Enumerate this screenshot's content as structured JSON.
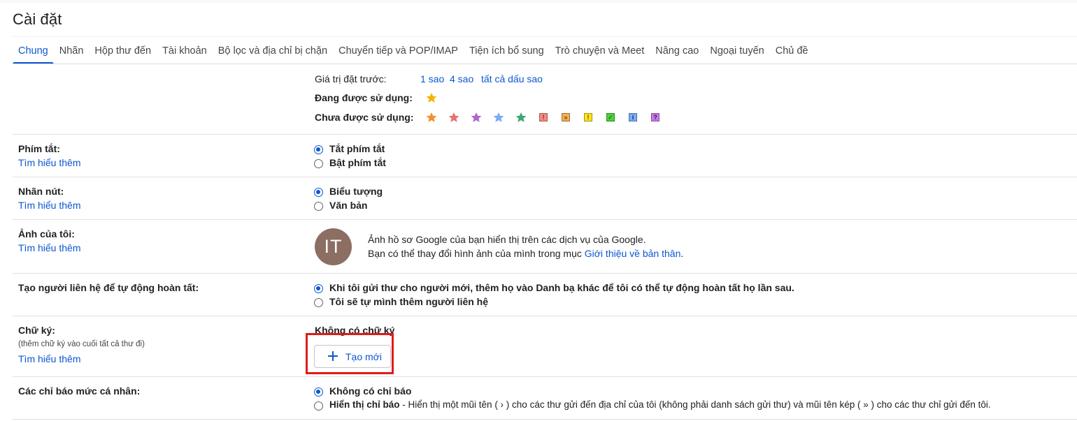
{
  "page_title": "Cài đặt",
  "tabs": [
    {
      "label": "Chung",
      "active": true
    },
    {
      "label": "Nhãn"
    },
    {
      "label": "Hộp thư đến"
    },
    {
      "label": "Tài khoản"
    },
    {
      "label": "Bộ lọc và địa chỉ bị chặn"
    },
    {
      "label": "Chuyển tiếp và POP/IMAP"
    },
    {
      "label": "Tiện ích bổ sung"
    },
    {
      "label": "Trò chuyện và Meet"
    },
    {
      "label": "Nâng cao"
    },
    {
      "label": "Ngoại tuyến"
    },
    {
      "label": "Chủ đề"
    }
  ],
  "stars": {
    "presets_label": "Giá trị đặt trước:",
    "preset_1": "1 sao",
    "preset_4": "4 sao",
    "preset_all": "tất cả dấu sao",
    "in_use_label": "Đang được sử dụng:",
    "not_in_use_label": "Chưa được sử dụng:",
    "in_use_color": "#f4b400",
    "not_in_use": [
      {
        "kind": "star",
        "color": "#f4902c",
        "name": "orange-star-icon"
      },
      {
        "kind": "star",
        "color": "#e57373",
        "name": "red-star-icon"
      },
      {
        "kind": "star",
        "color": "#ab68c9",
        "name": "purple-star-icon"
      },
      {
        "kind": "star",
        "color": "#7baaf7",
        "name": "blue-star-icon"
      },
      {
        "kind": "star",
        "color": "#3fa772",
        "name": "green-star-icon"
      },
      {
        "kind": "box",
        "glyph": "!",
        "bg": "#f28b82",
        "fg": "#b31412",
        "name": "red-bang-icon"
      },
      {
        "kind": "box",
        "glyph": "»",
        "bg": "#f6ad55",
        "fg": "#7a3b00",
        "name": "orange-guillemet-icon"
      },
      {
        "kind": "box",
        "glyph": "!",
        "bg": "#fbe41d",
        "fg": "#5f4a00",
        "name": "yellow-bang-icon"
      },
      {
        "kind": "box",
        "glyph": "✓",
        "bg": "#4cd13a",
        "fg": "#0b4d03",
        "name": "green-check-icon"
      },
      {
        "kind": "box",
        "glyph": "i",
        "bg": "#7baaf7",
        "fg": "#0a2d6e",
        "name": "blue-info-icon"
      },
      {
        "kind": "box",
        "glyph": "?",
        "bg": "#c77ae6",
        "fg": "#3f0a5a",
        "name": "purple-question-icon"
      }
    ]
  },
  "learn_more": "Tìm hiểu thêm",
  "shortcuts": {
    "label": "Phím tắt:",
    "off": "Tắt phím tắt",
    "on": "Bật phím tắt",
    "selected": "off"
  },
  "button_labels": {
    "label": "Nhãn nút:",
    "icons": "Biểu tượng",
    "text": "Văn bản",
    "selected": "icons"
  },
  "my_picture": {
    "label": "Ảnh của tôi:",
    "avatar_initials": "IT",
    "line1": "Ảnh hồ sơ Google của bạn hiển thị trên các dịch vụ của Google.",
    "line2_prefix": "Bạn có thể thay đổi hình ảnh của mình trong mục ",
    "line2_link": "Giới thiệu về bản thân",
    "line2_suffix": "."
  },
  "autocomplete": {
    "label": "Tạo người liên hệ để tự động hoàn tất:",
    "option_auto": "Khi tôi gửi thư cho người mới, thêm họ vào Danh bạ khác để tôi có thể tự động hoàn tất họ lần sau.",
    "option_manual": "Tôi sẽ tự mình thêm người liên hệ",
    "selected": "auto"
  },
  "signature": {
    "label": "Chữ ký:",
    "sublabel": "(thêm chữ ký vào cuối tất cả thư đi)",
    "none_text": "Không có chữ ký",
    "create_new": "Tạo mới"
  },
  "personal_indicators": {
    "label": "Các chỉ báo mức cá nhân:",
    "option_none": "Không có chỉ báo",
    "option_show": "Hiển thị chỉ báo",
    "option_show_desc": " - Hiển thị một mũi tên ( › ) cho các thư gửi đến địa chỉ của tôi (không phải danh sách gửi thư) và mũi tên kép ( » ) cho các thư chỉ gửi đến tôi.",
    "selected": "none"
  }
}
